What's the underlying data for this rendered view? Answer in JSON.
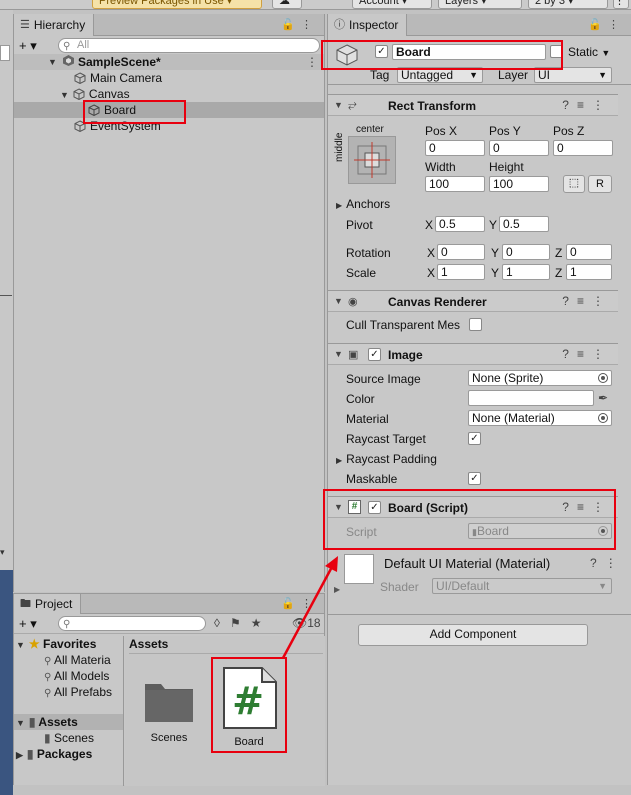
{
  "topbar": {
    "preview_label": "Preview Packages in Use ▾",
    "account_label": "Account ▾",
    "layers_label": "Layers ▾",
    "layout_label": "2 by 3 ▾"
  },
  "hierarchy": {
    "tab_label": "Hierarchy",
    "search_placeholder": "All",
    "add_label": "+ ▾",
    "scene_name": "SampleScene*",
    "items": [
      {
        "label": "Main Camera"
      },
      {
        "label": "Canvas"
      },
      {
        "label": "Board"
      },
      {
        "label": "EventSystem"
      }
    ]
  },
  "project": {
    "tab_label": "Project",
    "add_label": "+ ▾",
    "hidden_count": "18",
    "favorites_label": "Favorites",
    "favorites": [
      "All Materia",
      "All Models",
      "All Prefabs"
    ],
    "assets_label": "Assets",
    "assets_children": [
      "Scenes"
    ],
    "packages_label": "Packages",
    "breadcrumb": "Assets",
    "files": [
      {
        "name": "Scenes"
      },
      {
        "name": "Board"
      }
    ]
  },
  "inspector": {
    "tab_label": "Inspector",
    "object_name": "Board",
    "static_label": "Static",
    "tag_label": "Tag",
    "tag_value": "Untagged",
    "layer_label": "Layer",
    "layer_value": "UI",
    "rect_transform": {
      "title": "Rect Transform",
      "anchor_h": "center",
      "anchor_v": "middle",
      "posx_label": "Pos X",
      "posy_label": "Pos Y",
      "posz_label": "Pos Z",
      "posx": "0",
      "posy": "0",
      "posz": "0",
      "width_label": "Width",
      "height_label": "Height",
      "width": "100",
      "height": "100",
      "r_label": "R",
      "anchors_label": "Anchors",
      "pivot_label": "Pivot",
      "pivot_x": "0.5",
      "pivot_y": "0.5",
      "rotation_label": "Rotation",
      "rot_x": "0",
      "rot_y": "0",
      "rot_z": "0",
      "scale_label": "Scale",
      "scale_x": "1",
      "scale_y": "1",
      "scale_z": "1",
      "x": "X",
      "y": "Y",
      "z": "Z"
    },
    "canvas_renderer": {
      "title": "Canvas Renderer",
      "cull_label": "Cull Transparent Mes"
    },
    "image": {
      "title": "Image",
      "source_label": "Source Image",
      "source_value": "None (Sprite)",
      "color_label": "Color",
      "material_label": "Material",
      "material_value": "None (Material)",
      "raycast_label": "Raycast Target",
      "padding_label": "Raycast Padding",
      "maskable_label": "Maskable"
    },
    "script": {
      "title": "Board (Script)",
      "script_label": "Script",
      "script_value": "Board"
    },
    "material": {
      "title": "Default UI Material (Material)",
      "shader_label": "Shader",
      "shader_value": "UI/Default"
    },
    "add_component_label": "Add Component"
  },
  "colors": {
    "highlight": "#e8000f",
    "script_green": "#2e7d32"
  }
}
